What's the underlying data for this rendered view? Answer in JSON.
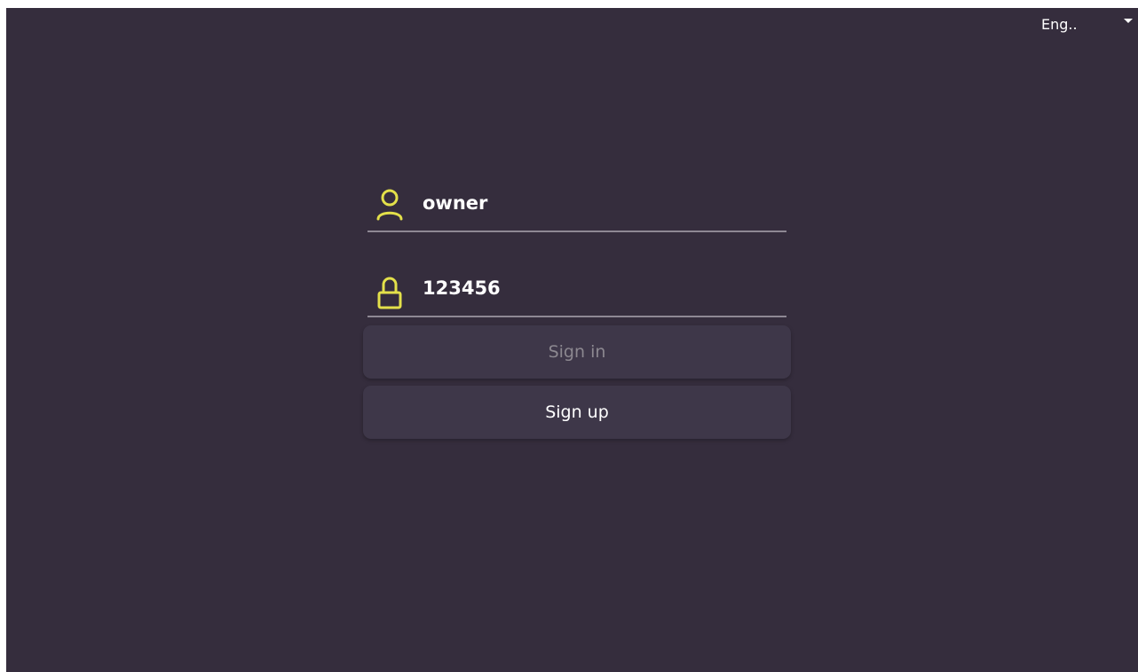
{
  "language_selector": {
    "selected": "Eng..",
    "caret_icon": "caret-down-icon"
  },
  "login_form": {
    "username": {
      "icon": "user-icon",
      "value": "owner"
    },
    "password": {
      "icon": "lock-icon",
      "value": "123456"
    },
    "sign_in_label": "Sign in",
    "sign_up_label": "Sign up"
  },
  "colors": {
    "background": "#352d3d",
    "accent_icon": "#e3e04a",
    "button_bg": "#3e3749",
    "underline": "#8e8894",
    "disabled_text": "#8c8890"
  }
}
